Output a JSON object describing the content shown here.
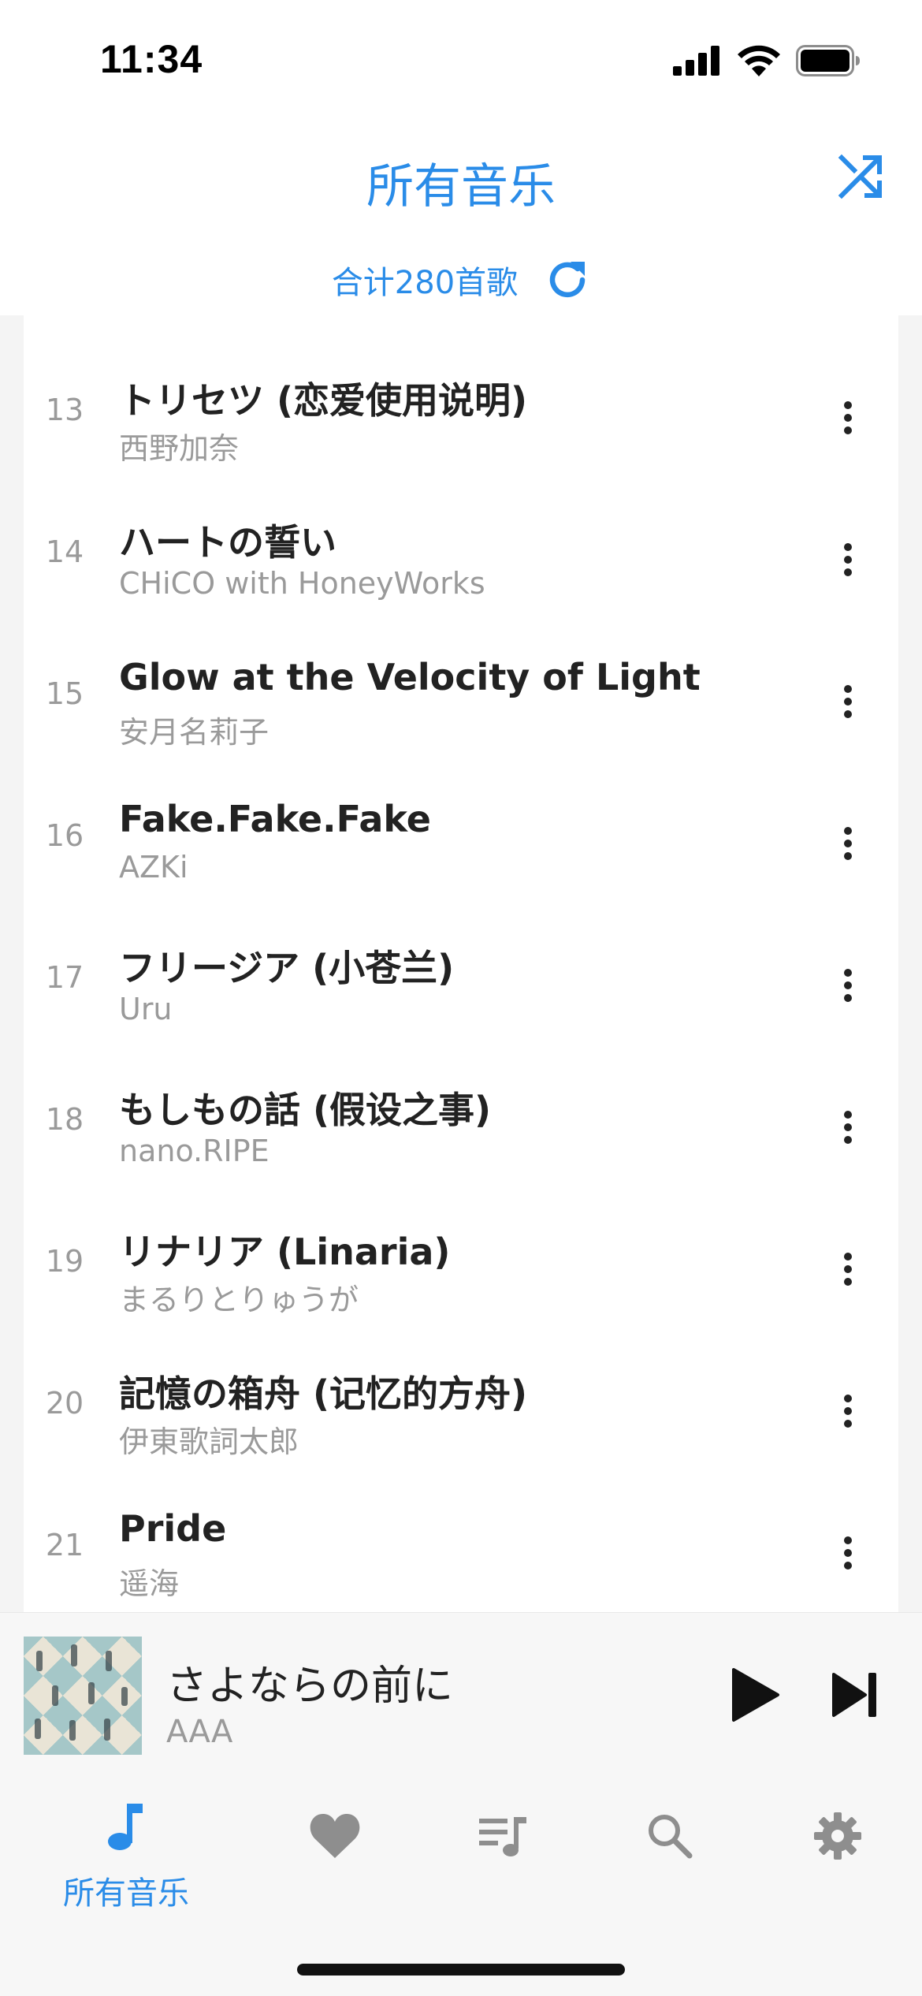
{
  "status_bar": {
    "time": "11:34",
    "icons": [
      "signal-icon",
      "wifi-icon",
      "battery-icon"
    ]
  },
  "header": {
    "title": "所有音乐",
    "song_count": "合计280首歌",
    "icons": [
      "shuffle-icon",
      "refresh-icon"
    ]
  },
  "colors": {
    "accent": "#2a8ce8",
    "text_primary": "#222222",
    "text_secondary": "#9a9a9a",
    "inactive_icon": "#8e8e8e"
  },
  "songs": [
    {
      "index": "13",
      "title": "トリセツ (恋爱使用说明)",
      "artist": "西野加奈"
    },
    {
      "index": "14",
      "title": "ハートの誓い",
      "artist": "CHiCO with HoneyWorks"
    },
    {
      "index": "15",
      "title": "Glow at the Velocity of Light",
      "artist": "安月名莉子"
    },
    {
      "index": "16",
      "title": "Fake.Fake.Fake",
      "artist": "AZKi"
    },
    {
      "index": "17",
      "title": "フリージア (小苍兰)",
      "artist": "Uru"
    },
    {
      "index": "18",
      "title": "もしもの話 (假设之事)",
      "artist": "nano.RIPE"
    },
    {
      "index": "19",
      "title": "リナリア (Linaria)",
      "artist": "まるりとりゅうが"
    },
    {
      "index": "20",
      "title": "記憶の箱舟 (记忆的方舟)",
      "artist": "伊東歌詞太郎"
    },
    {
      "index": "21",
      "title": "Pride",
      "artist": "遥海"
    }
  ],
  "now_playing": {
    "title": "さよならの前に",
    "artist": "AAA",
    "icons": [
      "album-art",
      "play-icon",
      "next-track-icon"
    ]
  },
  "tab_bar": {
    "tabs": [
      {
        "id": "music",
        "icon": "music-note-icon",
        "label": "所有音乐",
        "active": true
      },
      {
        "id": "favorites",
        "icon": "heart-icon",
        "label": "",
        "active": false
      },
      {
        "id": "playlists",
        "icon": "playlist-icon",
        "label": "",
        "active": false
      },
      {
        "id": "search",
        "icon": "search-icon",
        "label": "",
        "active": false
      },
      {
        "id": "settings",
        "icon": "gear-icon",
        "label": "",
        "active": false
      }
    ]
  }
}
